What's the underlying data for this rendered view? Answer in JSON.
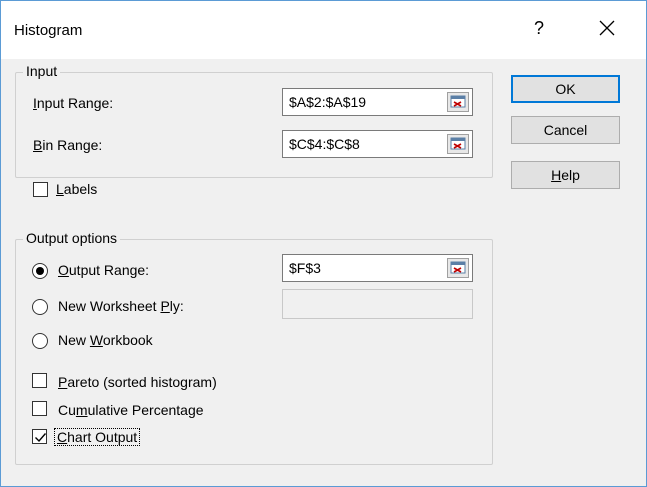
{
  "window": {
    "title": "Histogram",
    "help_label": "?",
    "close_icon": "close-icon"
  },
  "input_group": {
    "label": "Input",
    "input_range": {
      "label_u": "I",
      "label_rest": "nput Range:",
      "value": "$A$2:$A$19"
    },
    "bin_range": {
      "label_u": "B",
      "label_rest": "in Range:",
      "value": "$C$4:$C$8"
    }
  },
  "labels_option": {
    "label_u": "L",
    "label_rest": "abels",
    "checked": false
  },
  "output_group": {
    "label": "Output options",
    "output_range": {
      "label_u": "O",
      "label_rest": "utput Range:",
      "value": "$F$3",
      "selected": true
    },
    "new_worksheet": {
      "label_pre": "New Worksheet ",
      "label_u": "P",
      "label_rest": "ly:",
      "value": "",
      "selected": false
    },
    "new_workbook": {
      "label_pre": "New ",
      "label_u": "W",
      "label_rest": "orkbook",
      "selected": false
    },
    "pareto": {
      "label_u": "P",
      "label_rest": "areto (sorted histogram)",
      "checked": false
    },
    "cumulative": {
      "label_pre": "Cu",
      "label_u": "m",
      "label_rest": "ulative Percentage",
      "checked": false
    },
    "chart_output": {
      "label_u": "C",
      "label_rest": "hart Output",
      "checked": true
    }
  },
  "buttons": {
    "ok": "OK",
    "cancel": "Cancel",
    "help_u": "H",
    "help_rest": "elp"
  },
  "icons": {
    "collapse_dialog": "collapse-dialog-icon",
    "checkmark": "checkmark-icon"
  },
  "colors": {
    "accent": "#0078d7",
    "frame": "#5b9bd5",
    "dialog_bg": "#f0f0f0"
  }
}
